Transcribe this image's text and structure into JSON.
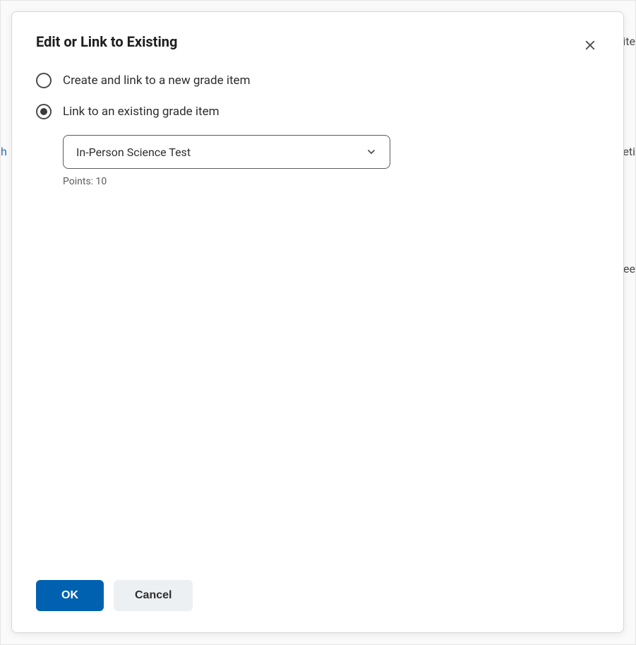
{
  "dialog": {
    "title": "Edit or Link to Existing",
    "options": {
      "create": {
        "label": "Create and link to a new grade item",
        "selected": false
      },
      "link": {
        "label": "Link to an existing grade item",
        "selected": true,
        "dropdown_value": "In-Person Science Test",
        "points_label": "Points: 10"
      }
    },
    "footer": {
      "ok_label": "OK",
      "cancel_label": "Cancel"
    }
  },
  "background_fragments": {
    "frag1": "ite",
    "frag2": "eti",
    "frag3": "Fee",
    "frag4": "h"
  }
}
